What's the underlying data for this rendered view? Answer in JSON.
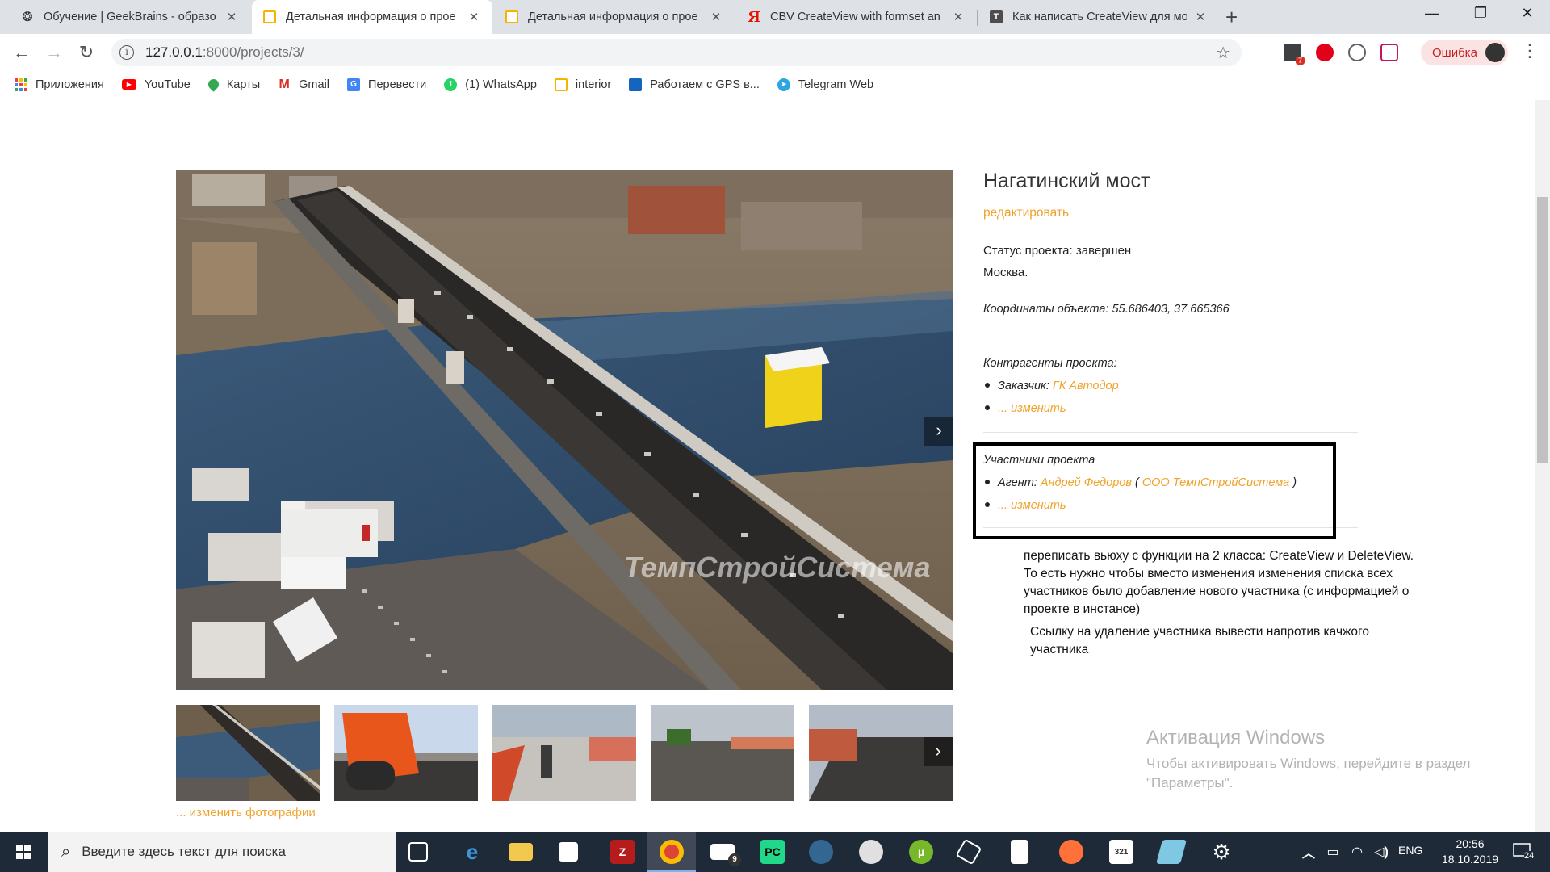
{
  "browser": {
    "tabs": [
      {
        "title": "Обучение | GeekBrains - образо",
        "icon": "geekbrains-icon",
        "color": "#333333",
        "active": false
      },
      {
        "title": "Детальная информация о прое",
        "icon": "page-icon",
        "color": "#f4b400",
        "active": true
      },
      {
        "title": "Детальная информация о прое",
        "icon": "page-icon",
        "color": "#f4b400",
        "active": false
      },
      {
        "title": "CBV CreateView with formset an",
        "icon": "yandex-icon",
        "color": "#e61400",
        "active": false
      },
      {
        "title": "Как написать CreateView для мо",
        "icon": "habr-icon",
        "color": "#4d4d4d",
        "active": false
      }
    ],
    "new_tab": "+",
    "window_controls": {
      "minimize": "—",
      "maximize": "❐",
      "close": "✕"
    },
    "url_host": "127.0.0.1",
    "url_path": ":8000/projects/3/",
    "profile_error": "Ошибка",
    "ext_badge": "7",
    "bookmarks": [
      {
        "label": "Приложения",
        "icon": "apps-grid-icon",
        "color": "#4285f4"
      },
      {
        "label": "YouTube",
        "icon": "youtube-icon",
        "color": "#ff0000"
      },
      {
        "label": "Карты",
        "icon": "maps-icon",
        "color": "#34a853"
      },
      {
        "label": "Gmail",
        "icon": "gmail-icon",
        "color": "#d93025"
      },
      {
        "label": "Перевести",
        "icon": "translate-icon",
        "color": "#4285f4"
      },
      {
        "label": "(1) WhatsApp",
        "icon": "whatsapp-icon",
        "color": "#25d366"
      },
      {
        "label": "interior",
        "icon": "page-icon",
        "color": "#f4b400"
      },
      {
        "label": "Работаем с GPS в...",
        "icon": "gps-icon",
        "color": "#1565c0"
      },
      {
        "label": "Telegram Web",
        "icon": "telegram-icon",
        "color": "#2ca5e0"
      }
    ]
  },
  "project": {
    "title": "Нагатинский мост",
    "edit_link": "редактировать",
    "status": "Статус проекта: завершен",
    "city": "Москва.",
    "coords": "Координаты объекта: 55.686403, 37.665366",
    "contractors_heading": "Контрагенты проекта:",
    "customer_label": "Заказчик:",
    "customer_link": "ГК Автодор",
    "contractors_change": "... изменить",
    "participants_heading": "Участники проекта",
    "agent_label": "Агент:",
    "agent_link": "Андрей Федоров",
    "agent_company": "ООО ТемпСтройСистема",
    "participants_change": "... изменить",
    "edit_photos": "... изменить фотографии",
    "watermark": "ТемпСтройСистема",
    "next_arrow": "›"
  },
  "note": {
    "p1": "переписать вьюху с функции на 2 класса: CreateView и DeleteView. То есть нужно чтобы вместо изменения изменения списка всех участников было добавление нового участника (с информацией о проекте в инстансе)",
    "p2": "Ссылку на удаление участника вывести напротив качжого участника"
  },
  "activation": {
    "title": "Активация Windows",
    "body": "Чтобы активировать Windows, перейдите в раздел \"Параметры\"."
  },
  "taskbar": {
    "search_placeholder": "Введите здесь текст для поиска",
    "mail_badge": "9",
    "lang": "ENG",
    "time": "20:56",
    "date": "18.10.2019",
    "notif_count": "24"
  },
  "colors": {
    "accent": "#f0a22b",
    "taskbar": "#1f2a38"
  }
}
